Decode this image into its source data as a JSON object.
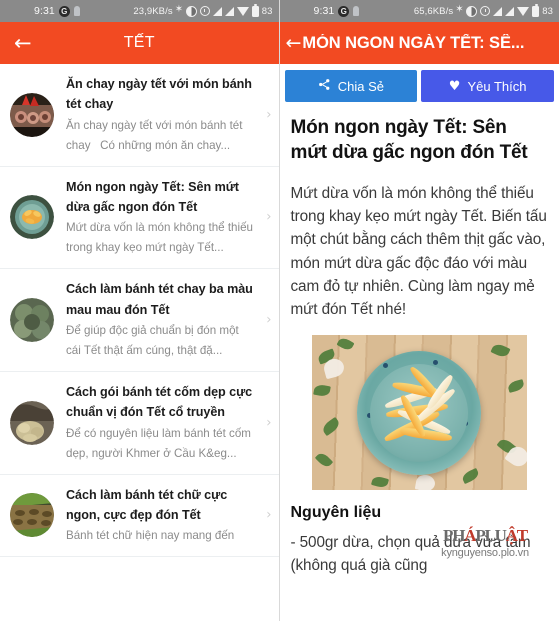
{
  "left": {
    "statusbar": {
      "clock": "9:31",
      "google_badge": "G",
      "network_speed": "23,9KB/s",
      "battery_pct": "83"
    },
    "appbar": {
      "back_icon": "←",
      "title": "TẾT"
    },
    "list_items": [
      {
        "title": "Ăn chay ngày tết với món bánh tét chay",
        "desc": "Ăn chay ngày tết với món bánh tét chay   Có những món ăn chay...",
        "chevron": "›"
      },
      {
        "title": "Món ngon ngày Tết: Sên mứt dừa gấc ngon đón Tết",
        "desc": "Mứt dừa vốn là món không thể thiếu trong khay kẹo mứt ngày Tết...",
        "chevron": "›"
      },
      {
        "title": "Cách làm bánh tét chay ba màu mau mau đón Tết",
        "desc": "Để giúp độc giả chuẩn bị đón một cái Tết thật ấm cúng, thật đặ...",
        "chevron": "›"
      },
      {
        "title": "Cách gói bánh tét cốm dẹp cực chuẩn vị đón Tết cổ truyền",
        "desc": "Để có nguyên liệu làm bánh tét cốm dẹp, người Khmer ở Cầu K&eg...",
        "chevron": "›"
      },
      {
        "title": "Cách làm bánh tét chữ cực ngon, cực đẹp đón Tết",
        "desc": "Bánh tét chữ hiện nay mang đến",
        "chevron": "›"
      }
    ]
  },
  "right": {
    "statusbar": {
      "clock": "9:31",
      "google_badge": "G",
      "network_speed": "65,6KB/s",
      "battery_pct": "83"
    },
    "appbar": {
      "back_icon": "←",
      "title": "MÓN NGON NGÀY TẾT: SÊ..."
    },
    "buttons": {
      "share_label": "Chia Sẻ",
      "share_icon": "≪",
      "share_color": "#2c82d6",
      "fav_label": "Yêu Thích",
      "fav_icon": "♥",
      "fav_color": "#4759e8"
    },
    "article": {
      "title": "Món ngon ngày Tết: Sên mứt dừa gấc ngon đón Tết",
      "paragraph": "Mứt dừa vốn là món không thể thiếu trong khay kẹo mứt ngày Tết. Biến tấu một chút bằng cách thêm thịt gấc vào, món mứt dừa gấc độc đáo với màu cam đỏ tự nhiên. Cùng làm ngay mẻ mứt đón Tết nhé!",
      "section_heading": "Nguyên liệu",
      "list_item": "- 500gr dừa, chọn quả dừa vừa tầm (không quá già cũng"
    },
    "watermark": {
      "logo_a": "PH",
      "logo_b": "Á",
      "logo_c": "PLU",
      "logo_d": "ẬT",
      "url": "kynguyenso.plo.vn"
    }
  },
  "colors": {
    "appbar": "#f24a22",
    "statusbar": "#8a8a8a",
    "divider": "#eceff1"
  }
}
